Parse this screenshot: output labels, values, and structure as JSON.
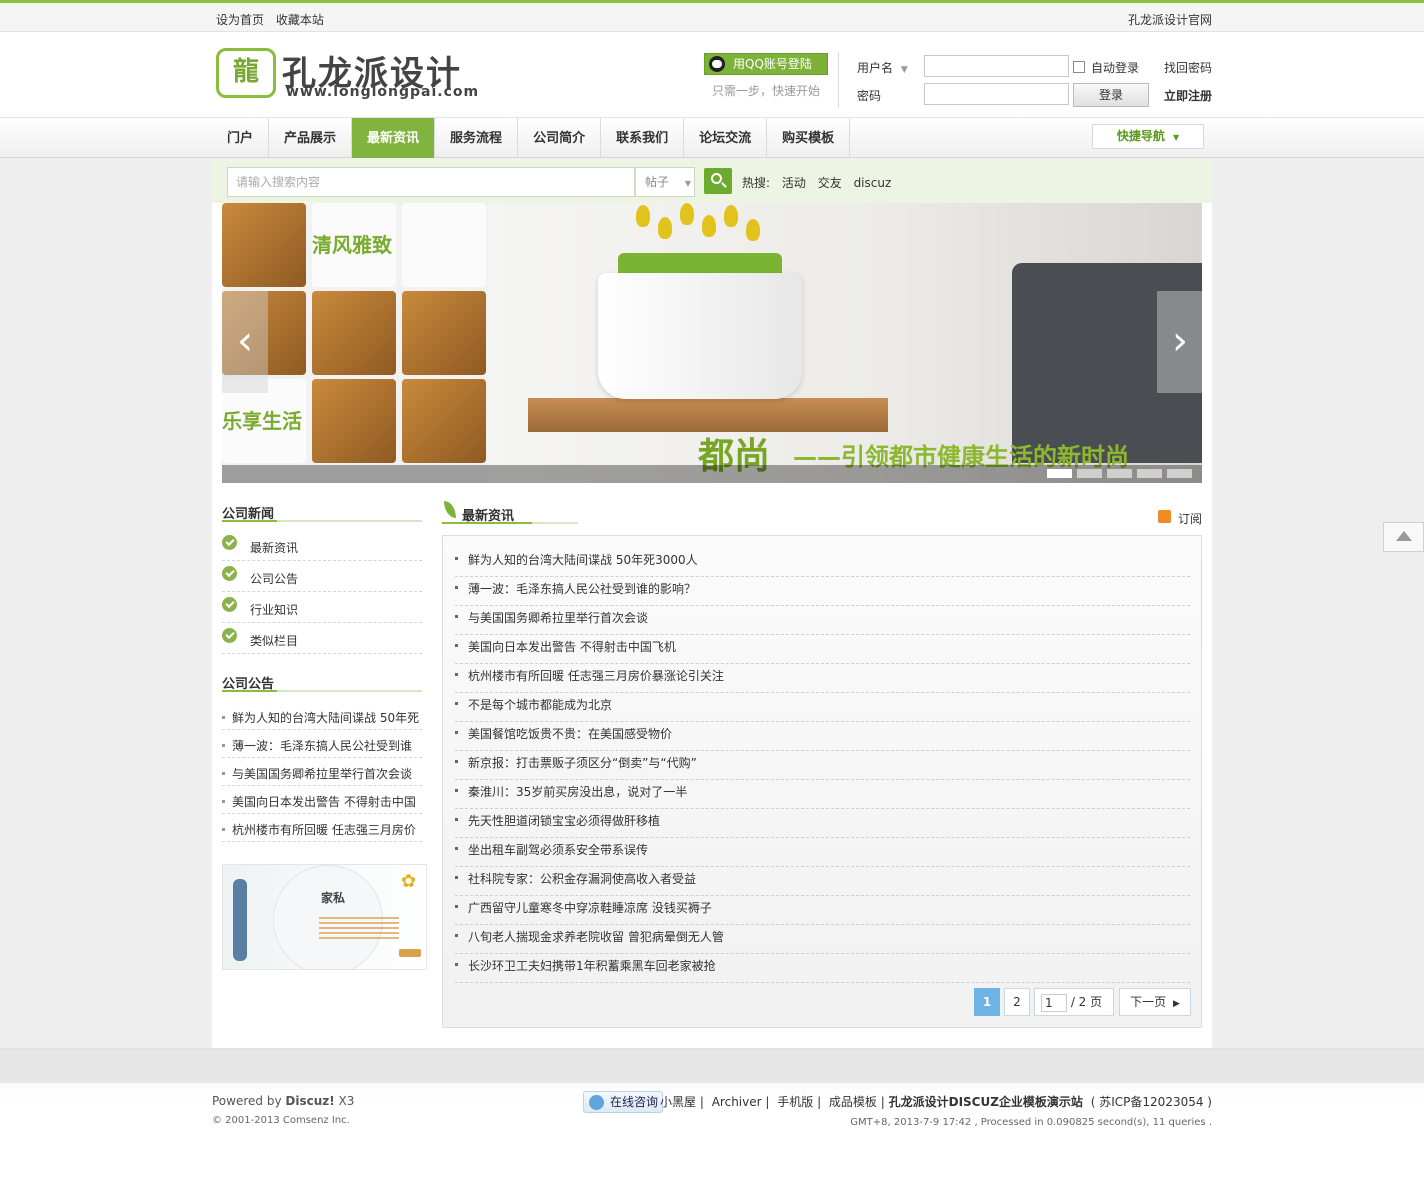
{
  "topbar": {
    "set_home": "设为首页",
    "bookmark": "收藏本站",
    "official": "孔龙派设计官网"
  },
  "logo": {
    "mark": "龍",
    "name": "孔龙派设计",
    "url": "www.longlongpai.com"
  },
  "login": {
    "qq_button": "用QQ账号登陆",
    "qq_tip": "只需一步，快速开始",
    "username_label": "用户名",
    "password_label": "密码",
    "auto_login": "自动登录",
    "login_button": "登录",
    "find_password": "找回密码",
    "register": "立即注册"
  },
  "nav": {
    "items": [
      "门户",
      "产品展示",
      "最新资讯",
      "服务流程",
      "公司简介",
      "联系我们",
      "论坛交流",
      "购买模板"
    ],
    "active": "最新资讯",
    "quick_nav": "快捷导航"
  },
  "search": {
    "placeholder": "请输入搜索内容",
    "type": "帖子",
    "hot_label": "热搜:",
    "hot": [
      "活动",
      "交友",
      "discuz"
    ]
  },
  "banner": {
    "left_text1": "清风雅致",
    "left_text2": "乐享生活",
    "slogan_main": "都尚",
    "slogan_sub": "——引领都市健康生活的新时尚",
    "slide_count": 5,
    "active_slide": 1
  },
  "sidebar": {
    "news_title": "公司新闻",
    "categories": [
      "最新资讯",
      "公司公告",
      "行业知识",
      "类似栏目"
    ],
    "notice_title": "公司公告",
    "notices": [
      "鲜为人知的台湾大陆间谍战 50年死",
      "薄一波：毛泽东搞人民公社受到谁",
      "与美国国务卿希拉里举行首次会谈",
      "美国向日本发出警告 不得射击中国",
      "杭州楼市有所回暖 任志强三月房价"
    ],
    "ad_title": "家私"
  },
  "main": {
    "title": "最新资讯",
    "subscribe": "订阅",
    "news": [
      "鲜为人知的台湾大陆间谍战 50年死3000人",
      "薄一波：毛泽东搞人民公社受到谁的影响？",
      "与美国国务卿希拉里举行首次会谈",
      "美国向日本发出警告 不得射击中国飞机",
      "杭州楼市有所回暖 任志强三月房价暴涨论引关注",
      "不是每个城市都能成为北京",
      "美国餐馆吃饭贵不贵：在美国感受物价",
      "新京报：打击票贩子须区分“倒卖”与“代购”",
      "秦淮川：35岁前买房没出息，说对了一半",
      "先天性胆道闭锁宝宝必须得做肝移植",
      "坐出租车副驾必须系安全带系误传",
      "社科院专家：公积金存漏洞使高收入者受益",
      "广西留守儿童寒冬中穿凉鞋睡凉席 没钱买褥子",
      "八旬老人揣现金求养老院收留 曾犯病晕倒无人管",
      "长沙环卫工夫妇携带1年积蓄乘黑车回老家被抢"
    ],
    "pagination": {
      "pages": [
        "1",
        "2"
      ],
      "current": "1",
      "jump_value": "1",
      "total": "/ 2 页",
      "next": "下一页"
    }
  },
  "footer": {
    "powered_prefix": "Powered by ",
    "powered_brand": "Discuz!",
    "powered_version": " X3",
    "copyright": "© 2001-2013 Comsenz Inc.",
    "online_consult": "在线咨询",
    "links": [
      "小黑屋",
      "Archiver",
      "手机版",
      "成品模板"
    ],
    "site": "孔龙派设计DISCUZ企业模板演示站",
    "icp": "( 苏ICP备12023054 )",
    "gmt": "GMT+8, 2013-7-9 17:42 , Processed in 0.090825 second(s), 11 queries ."
  },
  "colors": {
    "accent": "#80b43f",
    "page_bg": "#eeeeee",
    "pagination_active": "#6db3e6"
  }
}
